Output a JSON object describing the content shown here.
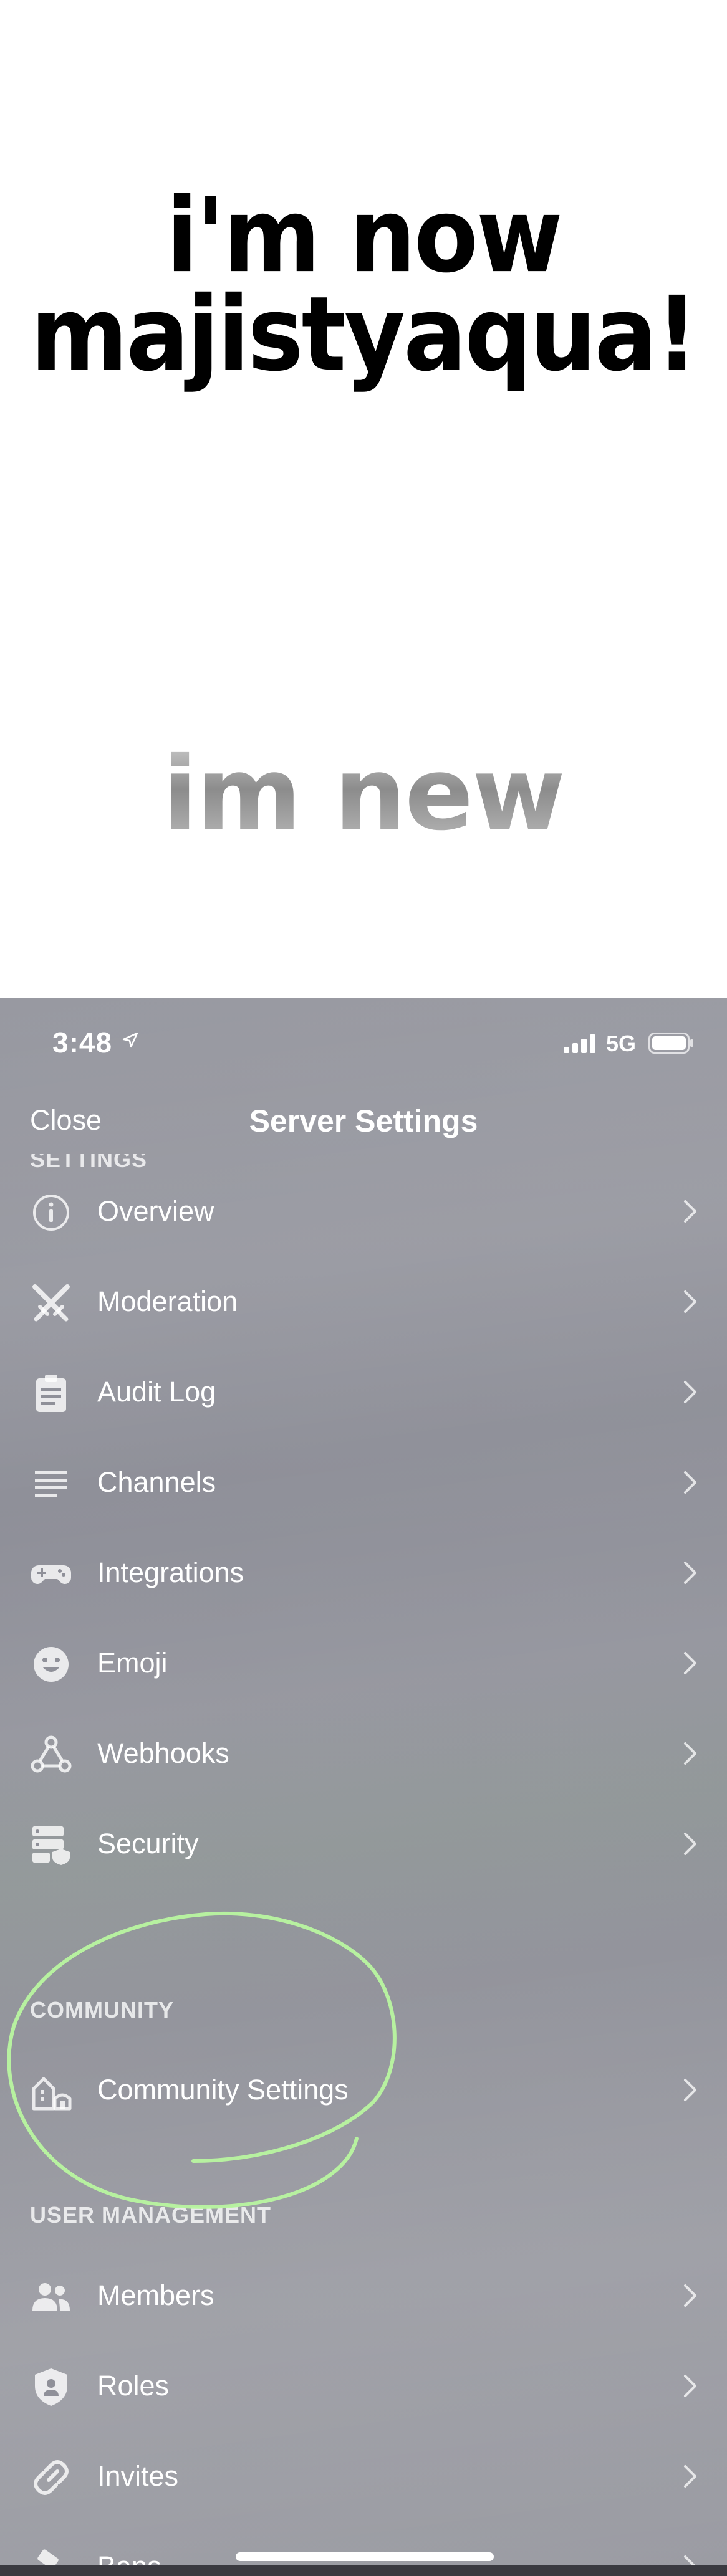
{
  "meme": {
    "top_line1": "i'm now",
    "top_line2": "majistyaqua!",
    "bottom_text": "im new"
  },
  "status_bar": {
    "time": "3:48",
    "network": "5G"
  },
  "nav": {
    "close_label": "Close",
    "title": "Server Settings"
  },
  "sections": {
    "settings_header": "SETTINGS",
    "community_header": "COMMUNITY",
    "user_management_header": "USER MANAGEMENT"
  },
  "settings_items": [
    {
      "label": "Overview",
      "icon": "info-icon"
    },
    {
      "label": "Moderation",
      "icon": "swords-icon"
    },
    {
      "label": "Audit Log",
      "icon": "clipboard-icon"
    },
    {
      "label": "Channels",
      "icon": "list-icon"
    },
    {
      "label": "Integrations",
      "icon": "gamepad-icon"
    },
    {
      "label": "Emoji",
      "icon": "smiley-icon"
    },
    {
      "label": "Webhooks",
      "icon": "webhook-icon"
    },
    {
      "label": "Security",
      "icon": "security-icon"
    }
  ],
  "community_items": [
    {
      "label": "Community Settings",
      "icon": "community-icon"
    }
  ],
  "user_management_items": [
    {
      "label": "Members",
      "icon": "members-icon"
    },
    {
      "label": "Roles",
      "icon": "shield-icon"
    },
    {
      "label": "Invites",
      "icon": "link-icon"
    },
    {
      "label": "Bans",
      "icon": "hammer-icon"
    }
  ],
  "colors": {
    "annotation_circle": "#b8f5a0",
    "text": "#ffffff"
  }
}
